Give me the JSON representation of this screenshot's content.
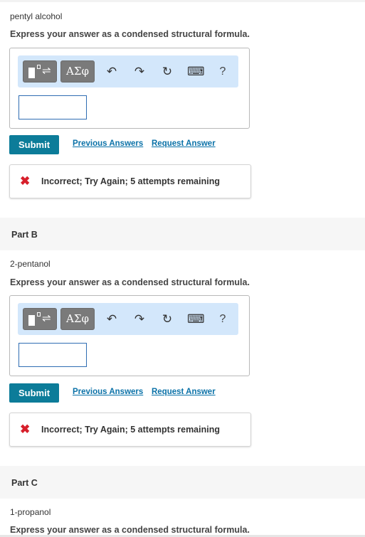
{
  "part_a": {
    "question": "pentyl alcohol",
    "instruction": "Express your answer as a condensed structural formula.",
    "toolbar": {
      "greek_label": "ΑΣφ",
      "help_label": "?"
    },
    "submit_label": "Submit",
    "previous_answers": "Previous Answers",
    "request_answer": "Request Answer",
    "feedback": "Incorrect; Try Again; 5 attempts remaining"
  },
  "part_b": {
    "title": "Part B",
    "question": "2-pentanol",
    "instruction": "Express your answer as a condensed structural formula.",
    "toolbar": {
      "greek_label": "ΑΣφ",
      "help_label": "?"
    },
    "submit_label": "Submit",
    "previous_answers": "Previous Answers",
    "request_answer": "Request Answer",
    "feedback": "Incorrect; Try Again; 5 attempts remaining"
  },
  "part_c": {
    "title": "Part C",
    "question": "1-propanol",
    "instruction": "Express your answer as a condensed structural formula."
  },
  "colors": {
    "submit": "#0c7c99",
    "link": "#0b72a8",
    "error": "#d71f2b",
    "toolbar": "#d3e7fb"
  },
  "icons": [
    "templates-icon",
    "undo-icon",
    "redo-icon",
    "reset-icon",
    "keyboard-icon",
    "help-icon",
    "incorrect-icon"
  ]
}
